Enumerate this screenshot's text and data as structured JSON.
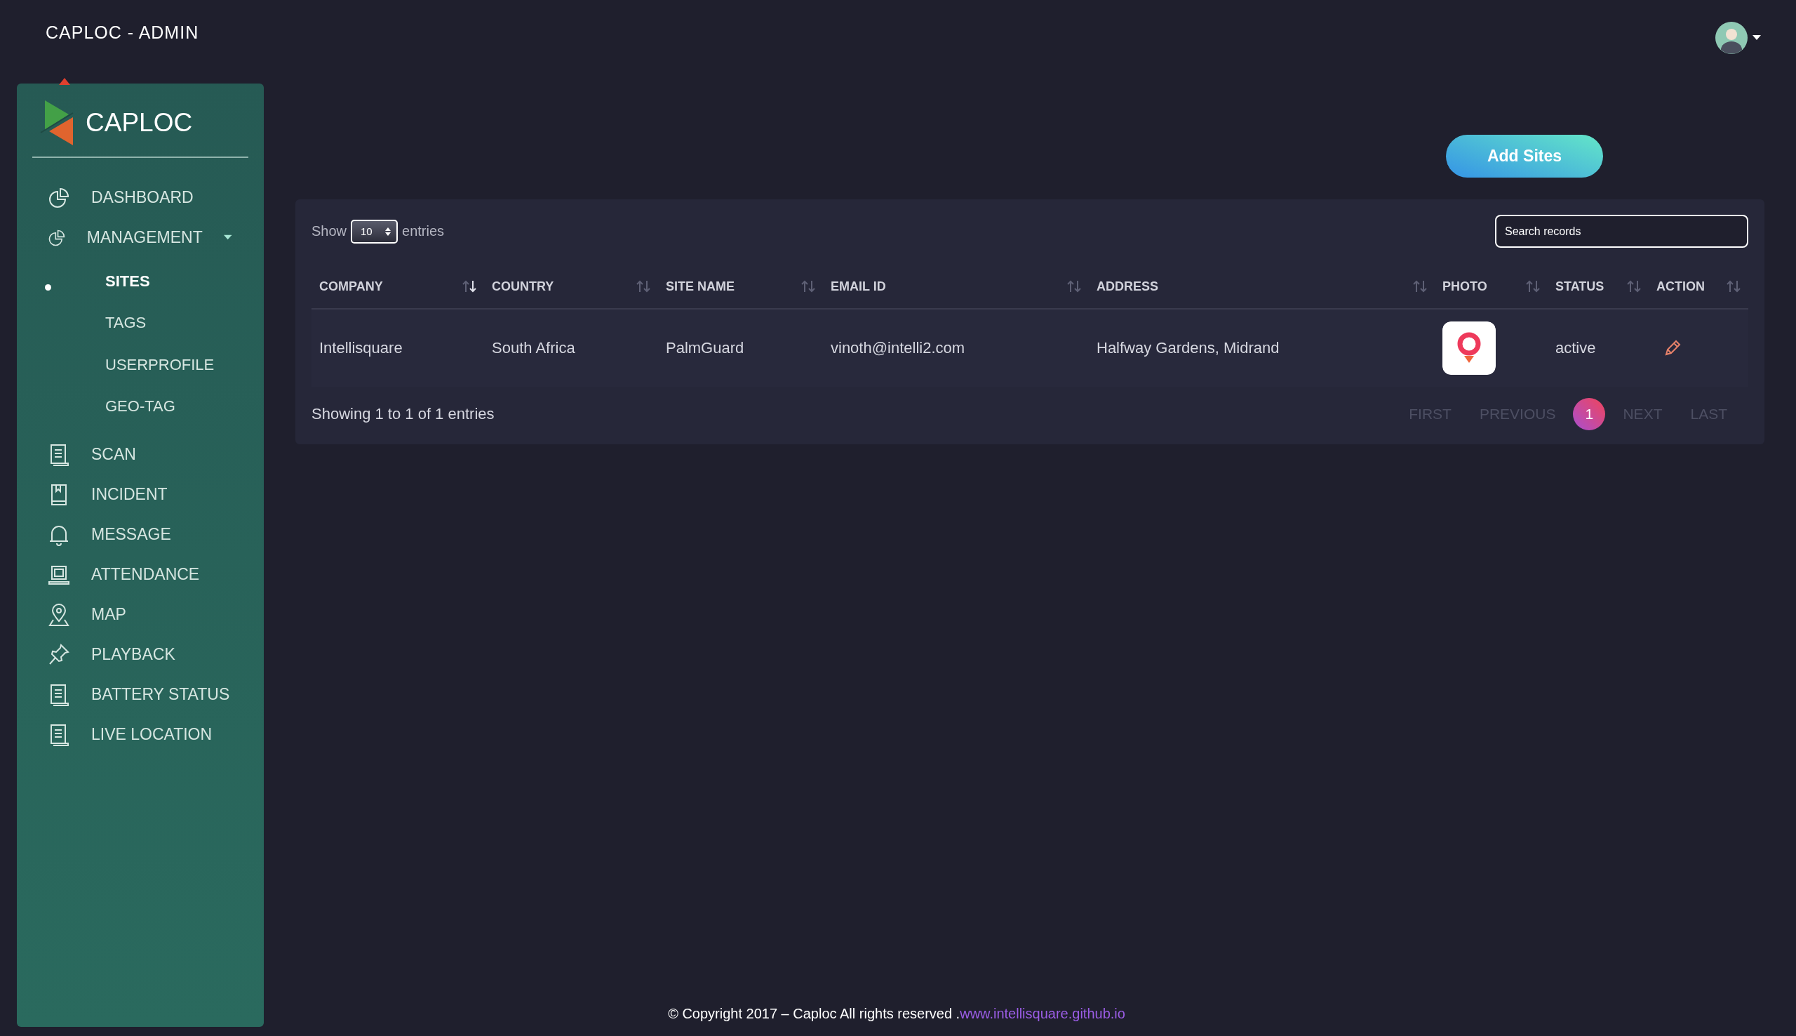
{
  "header": {
    "title": "CAPLOC - ADMIN"
  },
  "sidebar": {
    "brand": "CAPLOC",
    "items": [
      {
        "label": "DASHBOARD",
        "selected": false
      },
      {
        "label": "MANAGEMENT",
        "selected": false,
        "expanded": true,
        "children": [
          {
            "label": "SITES",
            "selected": true
          },
          {
            "label": "TAGS",
            "selected": false
          },
          {
            "label": "USERPROFILE",
            "selected": false
          },
          {
            "label": "GEO-TAG",
            "selected": false
          }
        ]
      },
      {
        "label": "SCAN",
        "selected": false
      },
      {
        "label": "INCIDENT",
        "selected": false
      },
      {
        "label": "MESSAGE",
        "selected": false
      },
      {
        "label": "ATTENDANCE",
        "selected": false
      },
      {
        "label": "MAP",
        "selected": false
      },
      {
        "label": "PLAYBACK",
        "selected": false
      },
      {
        "label": "BATTERY STATUS",
        "selected": false
      },
      {
        "label": "LIVE LOCATION",
        "selected": false
      }
    ]
  },
  "add_button": "Add Sites",
  "table": {
    "length": {
      "before": "Show",
      "value": "10",
      "after": "entries"
    },
    "search": {
      "placeholder": "Search records"
    },
    "columns": [
      {
        "label": "COMPANY",
        "sorted": true
      },
      {
        "label": "COUNTRY",
        "sorted": false
      },
      {
        "label": "SITE NAME",
        "sorted": false
      },
      {
        "label": "EMAIL ID",
        "sorted": false
      },
      {
        "label": "ADDRESS",
        "sorted": false
      },
      {
        "label": "PHOTO",
        "sorted": false
      },
      {
        "label": "STATUS",
        "sorted": false
      },
      {
        "label": "ACTION",
        "sorted": false
      }
    ],
    "rows": [
      {
        "company": "Intellisquare",
        "country": "South Africa",
        "site_name": "PalmGuard",
        "email_id": "vinoth@intelli2.com",
        "address": "Halfway Gardens, Midrand",
        "status": "active"
      }
    ],
    "info": "Showing 1 to 1 of 1 entries",
    "pagination": {
      "first": "FIRST",
      "previous": "PREVIOUS",
      "pages": [
        {
          "label": "1",
          "selected": true
        }
      ],
      "next": "NEXT",
      "last": "LAST"
    }
  },
  "footer": {
    "text": "© Copyright 2017 – Caploc All rights reserved .",
    "link": "www.intellisquare.github.io"
  }
}
